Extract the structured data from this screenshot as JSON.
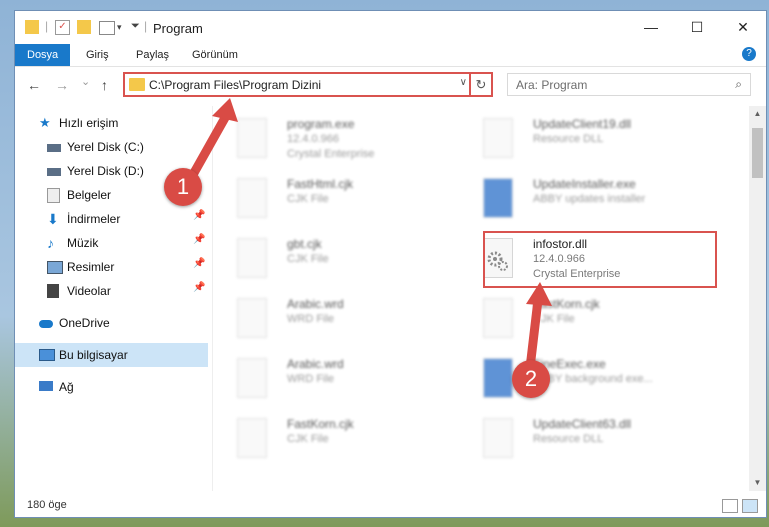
{
  "window": {
    "title": "Program",
    "controls": {
      "minimize": "—",
      "maximize": "☐",
      "close": "✕"
    }
  },
  "ribbon": {
    "tabs": [
      "Dosya",
      "Giriş",
      "Paylaş",
      "Görünüm"
    ]
  },
  "nav": {
    "back": "←",
    "forward": "→",
    "recent": "⌄",
    "up": "↑",
    "address": "C:\\Program Files\\Program Dizini",
    "search_placeholder": "Ara: Program"
  },
  "sidebar": {
    "items": [
      {
        "label": "Hızlı erişim",
        "icon": "star-icon",
        "pinned": false
      },
      {
        "label": "Yerel Disk (C:)",
        "icon": "drive-icon",
        "pinned": false
      },
      {
        "label": "Yerel Disk (D:)",
        "icon": "drive-icon",
        "pinned": false
      },
      {
        "label": "Belgeler",
        "icon": "documents-icon",
        "pinned": true
      },
      {
        "label": "İndirmeler",
        "icon": "download-icon",
        "pinned": true
      },
      {
        "label": "Müzik",
        "icon": "music-icon",
        "pinned": true
      },
      {
        "label": "Resimler",
        "icon": "pictures-icon",
        "pinned": true
      },
      {
        "label": "Videolar",
        "icon": "video-icon",
        "pinned": true
      },
      {
        "label": "OneDrive",
        "icon": "cloud-icon",
        "pinned": false
      },
      {
        "label": "Bu bilgisayar",
        "icon": "computer-icon",
        "pinned": false
      },
      {
        "label": "Ağ",
        "icon": "network-icon",
        "pinned": false
      }
    ]
  },
  "files": {
    "left": [
      {
        "name": "program.exe",
        "line2": "12.4.0.966",
        "line3": "Crystal Enterprise"
      },
      {
        "name": "FastHtml.cjk",
        "line2": "CJK File",
        "line3": ""
      },
      {
        "name": "gbt.cjk",
        "line2": "CJK File",
        "line3": ""
      },
      {
        "name": "Arabic.wrd",
        "line2": "WRD File",
        "line3": ""
      },
      {
        "name": "Arabic.wrd",
        "line2": "WRD File",
        "line3": ""
      },
      {
        "name": "FastKorn.cjk",
        "line2": "CJK File",
        "line3": ""
      }
    ],
    "right": [
      {
        "name": "UpdateClient19.dll",
        "line2": "Resource DLL",
        "line3": ""
      },
      {
        "name": "UpdateInstaller.exe",
        "line2": "ABBY updates installer",
        "line3": ""
      },
      {
        "name": "infostor.dll",
        "line2": "12.4.0.966",
        "line3": "Crystal Enterprise"
      },
      {
        "name": "FastKorn.cjk",
        "line2": "CJK File",
        "line3": ""
      },
      {
        "name": "FineExec.exe",
        "line2": "ABBY background exe...",
        "line3": ""
      },
      {
        "name": "UpdateClient63.dll",
        "line2": "Resource DLL",
        "line3": ""
      }
    ]
  },
  "status": {
    "count": "180 öge"
  },
  "callouts": [
    "1",
    "2"
  ],
  "colors": {
    "accent": "#1979ca",
    "highlight": "#d9534f"
  }
}
